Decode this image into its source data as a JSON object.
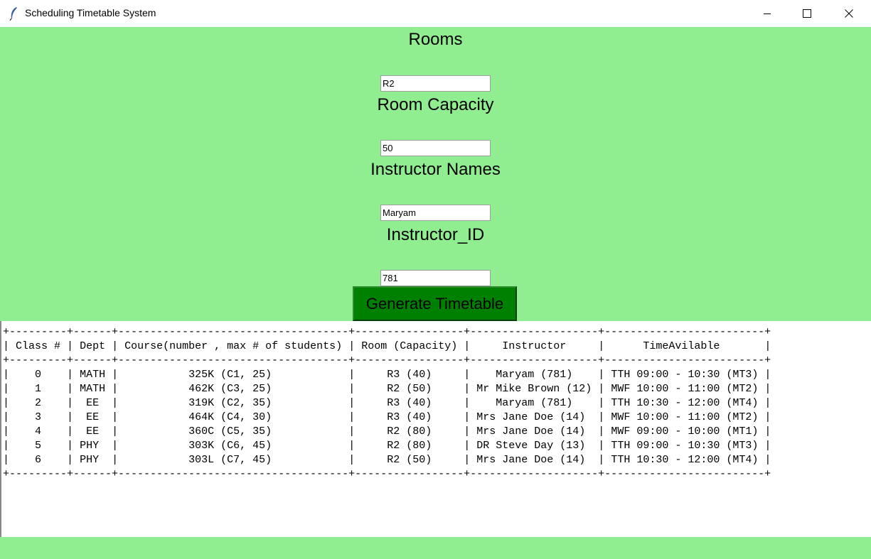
{
  "window": {
    "title": "Scheduling Timetable System"
  },
  "form": {
    "rooms_label": "Rooms",
    "rooms_value": "R2",
    "capacity_label": "Room Capacity",
    "capacity_value": "50",
    "instructor_label": "Instructor Names",
    "instructor_value": "Maryam",
    "instructor_id_label": "Instructor_ID",
    "instructor_id_value": "781",
    "generate_label": "Generate Timetable"
  },
  "timetable": {
    "columns": [
      "Class #",
      "Dept",
      "Course(number , max # of students)",
      "Room (Capacity)",
      "Instructor",
      "TimeAvilable"
    ],
    "rows": [
      [
        "0",
        "MATH",
        "325K (C1, 25)",
        "R3 (40)",
        "Maryam (781)",
        "TTH 09:00 - 10:30 (MT3)"
      ],
      [
        "1",
        "MATH",
        "462K (C3, 25)",
        "R2 (50)",
        "Mr Mike Brown (12)",
        "MWF 10:00 - 11:00 (MT2)"
      ],
      [
        "2",
        "EE",
        "319K (C2, 35)",
        "R3 (40)",
        "Maryam (781)",
        "TTH 10:30 - 12:00 (MT4)"
      ],
      [
        "3",
        "EE",
        "464K (C4, 30)",
        "R3 (40)",
        "Mrs Jane Doe (14)",
        "MWF 10:00 - 11:00 (MT2)"
      ],
      [
        "4",
        "EE",
        "360C (C5, 35)",
        "R2 (80)",
        "Mrs Jane Doe (14)",
        "MWF 09:00 - 10:00 (MT1)"
      ],
      [
        "5",
        "PHY",
        "303K (C6, 45)",
        "R2 (80)",
        "DR Steve Day (13)",
        "TTH 09:00 - 10:30 (MT3)"
      ],
      [
        "6",
        "PHY",
        "303L (C7, 45)",
        "R2 (50)",
        "Mrs Jane Doe (14)",
        "TTH 10:30 - 12:00 (MT4)"
      ]
    ]
  },
  "colors": {
    "panel_bg": "#90ee90",
    "button_bg": "#008000"
  }
}
